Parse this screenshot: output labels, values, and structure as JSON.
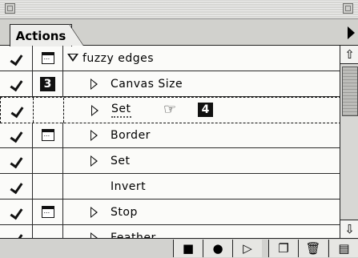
{
  "panel": {
    "tab_label": "Actions"
  },
  "rows": [
    {
      "checked": true,
      "dialog": true,
      "badge": "",
      "label": "fuzzy edges",
      "toggle": "expanded"
    },
    {
      "checked": true,
      "dialog": false,
      "badge": "3",
      "label": "Canvas Size",
      "toggle": "collapsed"
    },
    {
      "checked": true,
      "dialog": false,
      "badge": "",
      "label": "Set",
      "toggle": "collapsed",
      "dragging": true,
      "drag_badge": "4"
    },
    {
      "checked": true,
      "dialog": true,
      "badge": "",
      "label": "Border",
      "toggle": "collapsed"
    },
    {
      "checked": true,
      "dialog": false,
      "badge": "",
      "label": "Set",
      "toggle": "collapsed"
    },
    {
      "checked": true,
      "dialog": false,
      "badge": "",
      "label": "Invert",
      "toggle": "none"
    },
    {
      "checked": true,
      "dialog": true,
      "badge": "",
      "label": "Stop",
      "toggle": "collapsed"
    },
    {
      "checked": true,
      "dialog": false,
      "badge": "",
      "label": "Feather",
      "toggle": "collapsed"
    }
  ],
  "toolbar": {
    "buttons": [
      "stop-icon",
      "record-icon",
      "play-icon",
      "new-action-icon",
      "trash-icon"
    ]
  },
  "colors": {
    "panel_bg": "#fbfbf9",
    "chrome": "#d2d2cf",
    "ink": "#111111"
  }
}
